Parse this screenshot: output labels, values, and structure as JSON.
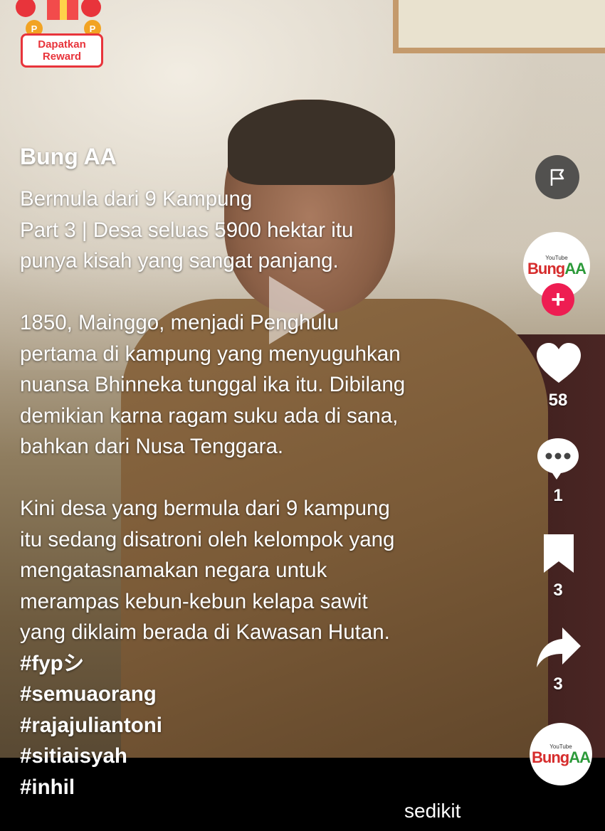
{
  "reward": {
    "label_line1": "Dapatkan",
    "label_line2": "Reward"
  },
  "post": {
    "author": "Bung AA",
    "caption_lines": [
      "Bermula dari 9 Kampung",
      "Part 3 | Desa seluas 5900 hektar itu",
      "punya kisah yang sangat panjang.",
      "",
      "1850, Mainggo, menjadi Penghulu",
      "pertama di kampung yang menyuguhkan",
      "nuansa Bhinneka tunggal ika itu. Dibilang",
      "demikian karna ragam suku ada di sana,",
      "bahkan dari Nusa Tenggara.",
      "",
      "Kini desa yang bermula dari 9 kampung",
      "itu sedang disatroni oleh kelompok yang",
      "mengatasnamakan negara untuk",
      "merampas kebun-kebun kelapa sawit",
      "yang diklaim berada di Kawasan Hutan."
    ],
    "hashtags": [
      "#fypシ",
      "#semuaorang",
      "#rajajuliantoni",
      "#sitiaisyah",
      "#inhil"
    ],
    "more_label": "sedikit"
  },
  "rail": {
    "avatar_logo": {
      "youtube": "YouTube",
      "name_a": "Bung",
      "name_b": "AA"
    },
    "likes": "58",
    "comments": "1",
    "saves": "3",
    "shares": "3"
  },
  "icons": {
    "report": "flag-icon",
    "like": "heart-icon",
    "comment": "comment-bubble-icon",
    "save": "bookmark-icon",
    "share": "share-arrow-icon",
    "follow": "plus-icon",
    "play": "play-icon"
  },
  "colors": {
    "accent": "#ee1d52",
    "reward_red": "#e8343b"
  }
}
